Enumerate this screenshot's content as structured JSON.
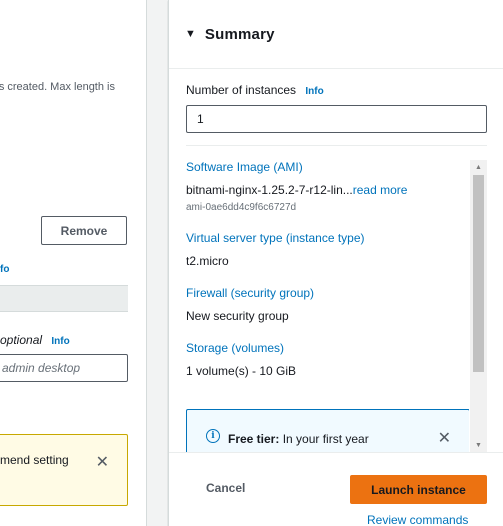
{
  "left": {
    "name_hint": "is created. Max length is",
    "remove_label": "Remove",
    "info_fragment": "fo",
    "optional_label": "optional",
    "info_label": "Info",
    "desc_placeholder": "admin desktop",
    "warning_text": "mend setting"
  },
  "summary": {
    "title": "Summary",
    "instances_label": "Number of instances",
    "info_label": "Info",
    "instances_value": "1",
    "ami": {
      "title": "Software Image (AMI)",
      "value": "bitnami-nginx-1.25.2-7-r12-lin...",
      "read_more": "read more",
      "id": "ami-0ae6dd4c9f6c6727d"
    },
    "instance_type": {
      "title": "Virtual server type (instance type)",
      "value": "t2.micro"
    },
    "firewall": {
      "title": "Firewall (security group)",
      "value": "New security group"
    },
    "storage": {
      "title": "Storage (volumes)",
      "value": "1 volume(s) - 10 GiB"
    },
    "free_tier": {
      "label": "Free tier:",
      "text": " In your first year"
    }
  },
  "footer": {
    "cancel_label": "Cancel",
    "launch_label": "Launch instance",
    "review_label": "Review commands"
  },
  "colors": {
    "accent": "#0073bb",
    "launch": "#ec7211",
    "warning_bg": "#fffbe5",
    "info_bg": "#f1faff"
  },
  "icons": {
    "collapse": "caret-down-icon",
    "close": "close-icon",
    "info": "info-circle-icon"
  }
}
